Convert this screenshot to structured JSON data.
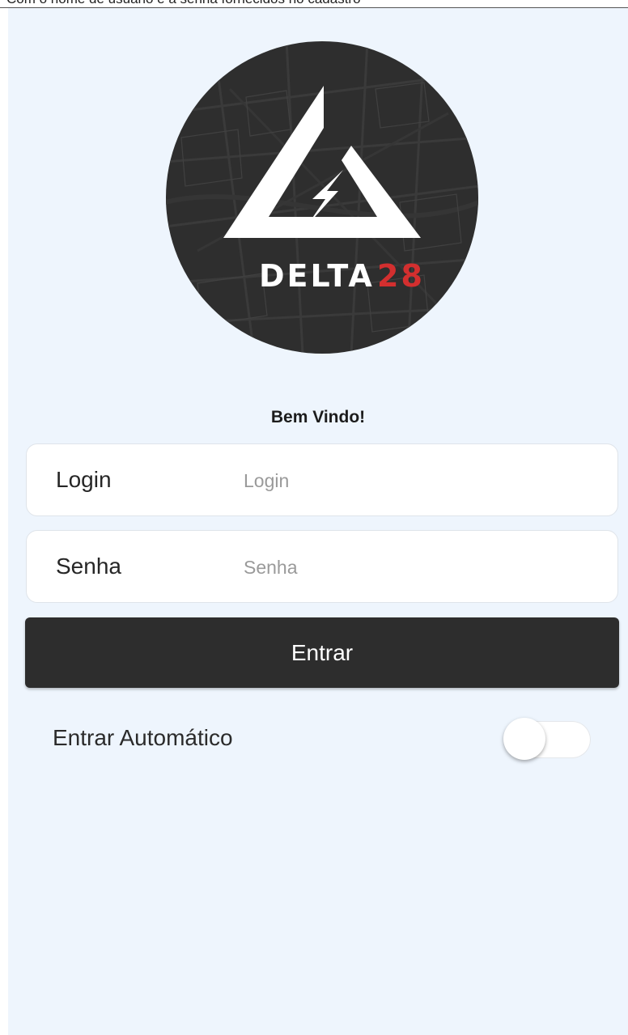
{
  "header": {
    "caption": "Com o nome de usuário e a senha fornecidos no cadastro"
  },
  "logo": {
    "text_main": "DELTA",
    "text_accent": "28",
    "accent_color": "#d32f2f",
    "background_color": "#2e2e2e",
    "icon": "lightning-bolt-icon"
  },
  "welcome": {
    "text": "Bem Vindo!"
  },
  "login_field": {
    "label": "Login",
    "placeholder": "Login",
    "value": ""
  },
  "password_field": {
    "label": "Senha",
    "placeholder": "Senha",
    "value": ""
  },
  "enter_button": {
    "label": "Entrar"
  },
  "auto_login": {
    "label": "Entrar Automático",
    "enabled": false
  }
}
